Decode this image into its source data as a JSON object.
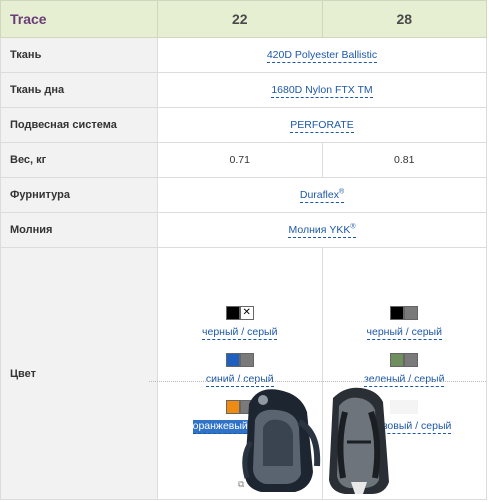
{
  "header": {
    "title": "Trace",
    "col1": "22",
    "col2": "28"
  },
  "rows": [
    {
      "label": "Ткань",
      "value": "420D Polyester Ballistic"
    },
    {
      "label": "Ткань дна",
      "value": "1680D Nylon FTX TM"
    },
    {
      "label": "Подвесная система",
      "value": "PERFORATE"
    },
    {
      "label": "Вес, кг",
      "value1": "0.71",
      "value2": "0.81"
    },
    {
      "label": "Фурнитура",
      "value": "Duraflex",
      "sup": "®"
    },
    {
      "label": "Молния",
      "value": "Молния YKK",
      "sup": "®"
    }
  ],
  "color_row": {
    "label": "Цвет",
    "col1": [
      {
        "name": "черный / серый",
        "swatch": [
          "#000000",
          "#7a7a7a"
        ],
        "selected_x": true
      },
      {
        "name": "синий / серый",
        "swatch": [
          "#1f5fbf",
          "#7a7a7a"
        ]
      },
      {
        "name": "оранжевый / серый",
        "swatch": [
          "#ef8a12",
          "#7a7a7a"
        ],
        "highlighted": true
      }
    ],
    "col2": [
      {
        "name": "черный / серый",
        "swatch": [
          "#000000",
          "#7a7a7a"
        ]
      },
      {
        "name": "зеленый / серый",
        "swatch": [
          "#6f8f5f",
          "#7a7a7a"
        ]
      },
      {
        "name": "бирюзовый / серый",
        "swatch": [
          "#eeeeee",
          "#eeeeee"
        ]
      }
    ]
  },
  "colors": {
    "header_bg": "#e6efd2",
    "title": "#6a3c78",
    "link": "#1d58a8",
    "label_bg": "#f2f2f2"
  }
}
